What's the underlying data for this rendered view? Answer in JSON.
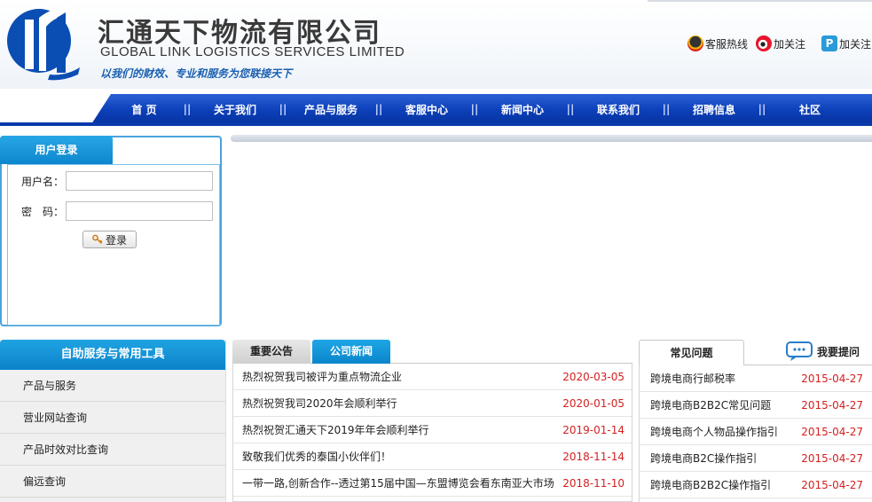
{
  "header": {
    "company_cn": "汇通天下物流有限公司",
    "company_en": "GLOBAL LINK LOGISTICS SERVICES LIMITED",
    "slogan": "以我们的财效、专业和服务为您联接天下",
    "social": [
      {
        "icon": "qq-icon",
        "label": "客服热线"
      },
      {
        "icon": "weibo-icon",
        "label": "加关注"
      },
      {
        "icon": "tencent-weibo-icon",
        "label": "加关注"
      }
    ]
  },
  "nav": {
    "items": [
      "首  页",
      "关于我们",
      "产品与服务",
      "客服中心",
      "新闻中心",
      "联系我们",
      "招聘信息",
      "社区"
    ],
    "separator": "||"
  },
  "login": {
    "title": "用户登录",
    "username_label": "用户名：",
    "password_label": "密　码：",
    "username_value": "",
    "password_value": "",
    "button_label": "登录"
  },
  "tools": {
    "title": "自助服务与常用工具",
    "items": [
      "产品与服务",
      "营业网站查询",
      "产品时效对比查询",
      "偏远查询"
    ]
  },
  "news": {
    "tabs": [
      "重要公告",
      "公司新闻"
    ],
    "active_tab": "公司新闻",
    "items": [
      {
        "title": "热烈祝贺我司被评为重点物流企业",
        "date": "2020-03-05"
      },
      {
        "title": "热烈祝贺我司2020年会顺利举行",
        "date": "2020-01-05"
      },
      {
        "title": "热烈祝贺汇通天下2019年年会顺利举行",
        "date": "2019-01-14"
      },
      {
        "title": "致敬我们优秀的泰国小伙伴们！",
        "date": "2018-11-14"
      },
      {
        "title": "一带一路,创新合作--透过第15届中国—东盟博览会看东南亚大市场",
        "date": "2018-11-10"
      }
    ]
  },
  "faq": {
    "tab": "常见问题",
    "ask_label": "我要提问",
    "items": [
      {
        "title": "跨境电商行邮税率",
        "date": "2015-04-27"
      },
      {
        "title": "跨境电商B2B2C常见问题",
        "date": "2015-04-27"
      },
      {
        "title": "跨境电商个人物品操作指引",
        "date": "2015-04-27"
      },
      {
        "title": "跨境电商B2C操作指引",
        "date": "2015-04-27"
      },
      {
        "title": "跨境电商B2B2C操作指引",
        "date": "2015-04-27"
      }
    ]
  },
  "colors": {
    "nav_blue": "#0c3fb8",
    "tab_blue": "#0b85cb",
    "date_red": "#d41f1f",
    "slogan_blue": "#1a5fb0"
  }
}
